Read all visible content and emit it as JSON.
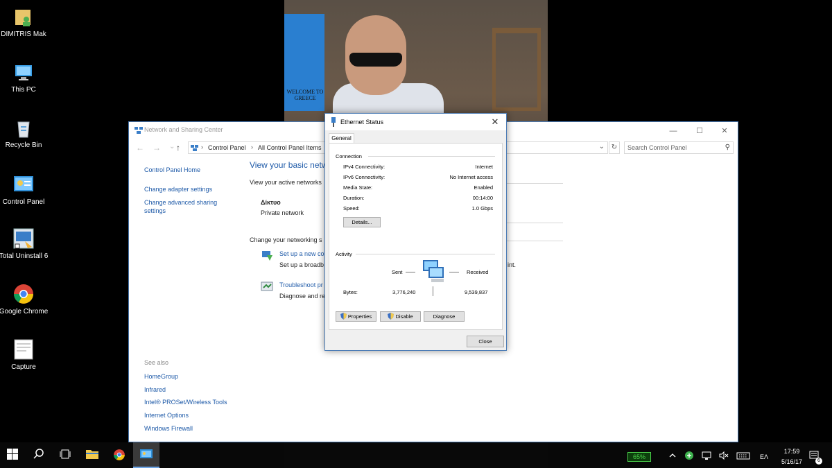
{
  "desktop": {
    "icons": [
      {
        "label": "DIMITRIS Mak"
      },
      {
        "label": "This PC"
      },
      {
        "label": "Recycle Bin"
      },
      {
        "label": "Control Panel"
      },
      {
        "label": "Total Uninstall 6"
      },
      {
        "label": "Google Chrome"
      },
      {
        "label": "Capture"
      }
    ],
    "wallpaper_bag_text": "WELCOME TO GREECE"
  },
  "nsc": {
    "title": "Network and Sharing Center",
    "breadcrumbs": [
      "Control Panel",
      "All Control Panel Items"
    ],
    "search_placeholder": "Search Control Panel",
    "sidebar": {
      "home": "Control Panel Home",
      "links": [
        "Change adapter settings",
        "Change advanced sharing settings"
      ],
      "see_also_label": "See also",
      "see_also": [
        "HomeGroup",
        "Infrared",
        "Intel® PROSet/Wireless Tools",
        "Internet Options",
        "Windows Firewall"
      ]
    },
    "main": {
      "heading": "View your basic netw",
      "active_networks": "View your active networks",
      "network_name": "Δίκτυο",
      "network_type": "Private network",
      "change_settings": "Change your networking s",
      "setup_link": "Set up a new co",
      "setup_desc": "Set up a broadb",
      "setup_desc_tail": "int.",
      "troubleshoot_link": "Troubleshoot pr",
      "troubleshoot_desc": "Diagnose and re"
    }
  },
  "ethernet_status": {
    "title": "Ethernet Status",
    "tab": "General",
    "connection_label": "Connection",
    "rows": [
      {
        "key": "IPv4 Connectivity:",
        "value": "Internet"
      },
      {
        "key": "IPv6 Connectivity:",
        "value": "No Internet access"
      },
      {
        "key": "Media State:",
        "value": "Enabled"
      },
      {
        "key": "Duration:",
        "value": "00:14:00"
      },
      {
        "key": "Speed:",
        "value": "1.0 Gbps"
      }
    ],
    "details_button": "Details...",
    "activity_label": "Activity",
    "sent_label": "Sent",
    "received_label": "Received",
    "bytes_label": "Bytes:",
    "bytes_sent": "3,776,240",
    "bytes_received": "9,539,837",
    "buttons": {
      "properties": "Properties",
      "disable": "Disable",
      "diagnose": "Diagnose"
    },
    "close_button": "Close"
  },
  "taskbar": {
    "battery": "65%",
    "language": "ΕΛ",
    "time": "17:59",
    "date": "5/16/17",
    "notification_count": "6",
    "accent": "#6ea6e6"
  }
}
